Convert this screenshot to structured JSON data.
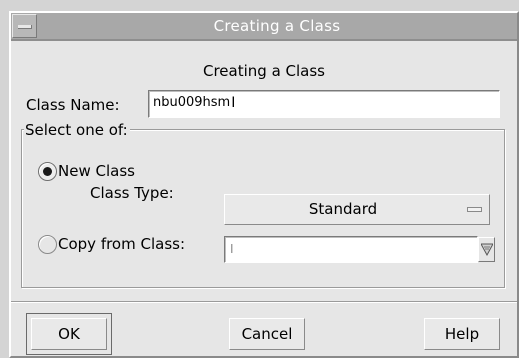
{
  "window": {
    "title": "Creating a Class",
    "menu_icon": "window-menu-icon"
  },
  "dialog": {
    "heading": "Creating a Class",
    "class_name_label": "Class Name:",
    "class_name_value": "nbu009hsm",
    "group_title": "Select one of:",
    "new_class": {
      "label": "New Class",
      "selected": true,
      "class_type_label": "Class Type:",
      "class_type_value": "Standard"
    },
    "copy_from": {
      "label": "Copy from Class:",
      "selected": false,
      "value": ""
    }
  },
  "buttons": {
    "ok": "OK",
    "cancel": "Cancel",
    "help": "Help"
  },
  "icons": {
    "combo_arrow": "chevron-down-icon",
    "option_indicator": "option-menu-indicator-icon",
    "cursor": "text-cursor-icon"
  },
  "colors": {
    "titlebar": "#a8a8a8",
    "dialog_background": "#e6e6e6",
    "input_background": "#ffffff"
  }
}
